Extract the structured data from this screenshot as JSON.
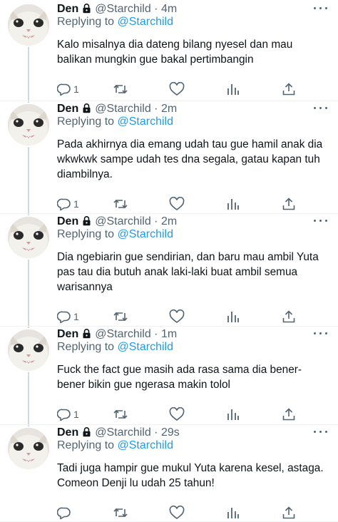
{
  "tweets": [
    {
      "name": "Den",
      "handle": "@Starchild",
      "time": "4m",
      "replying_prefix": "Replying to",
      "replying_to": "@Starchild",
      "text": "Kalo misalnya dia dateng bilang nyesel dan mau balikan mungkin gue bakal pertimbangin",
      "reply_count": "1"
    },
    {
      "name": "Den",
      "handle": "@Starchild",
      "time": "2m",
      "replying_prefix": "Replying to",
      "replying_to": "@Starchild",
      "text": "Pada akhirnya dia emang udah tau gue hamil anak dia wkwkwk sampe udah tes dna segala, gatau kapan tuh diambilnya.",
      "reply_count": "1"
    },
    {
      "name": "Den",
      "handle": "@Starchild",
      "time": "2m",
      "replying_prefix": "Replying to",
      "replying_to": "@Starchild",
      "text": "Dia ngebiarin gue sendirian, dan baru mau ambil Yuta pas tau dia butuh anak laki-laki buat ambil semua warisannya",
      "reply_count": "1"
    },
    {
      "name": "Den",
      "handle": "@Starchild",
      "time": "1m",
      "replying_prefix": "Replying to",
      "replying_to": "@Starchild",
      "text": "Fuck the fact gue masih ada rasa sama dia bener-bener bikin gue ngerasa makin tolol",
      "reply_count": "1"
    },
    {
      "name": "Den",
      "handle": "@Starchild",
      "time": "29s",
      "replying_prefix": "Replying to",
      "replying_to": "@Starchild",
      "text": "Tadi juga hampir gue mukul Yuta karena kesel, astaga. Comeon Denji lu udah 25 tahun!",
      "reply_count": ""
    }
  ],
  "icons": {
    "avatar": "cat-avatar",
    "lock": "lock-icon",
    "more": "more-icon",
    "reply": "reply-icon",
    "retweet": "retweet-icon",
    "like": "heart-icon",
    "views": "analytics-icon",
    "share": "share-icon"
  },
  "colors": {
    "text": "#0f1419",
    "secondary": "#536471",
    "mention": "#1d9bf0",
    "thread_line": "#cfd9de"
  }
}
